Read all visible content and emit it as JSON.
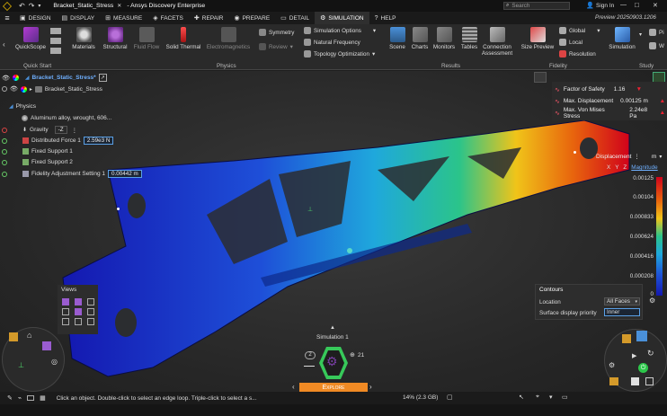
{
  "titlebar": {
    "doc_title": "Bracket_Static_Stress",
    "app_title": "- Ansys Discovery Enterprise",
    "search_placeholder": "Search",
    "sign_in": "Sign In",
    "window_controls": [
      "—",
      "□",
      "✕"
    ]
  },
  "tabs": [
    {
      "label": "Design",
      "icon": "design-icon"
    },
    {
      "label": "Display",
      "icon": "display-icon"
    },
    {
      "label": "Measure",
      "icon": "measure-icon"
    },
    {
      "label": "Facets",
      "icon": "facets-icon"
    },
    {
      "label": "Repair",
      "icon": "repair-icon"
    },
    {
      "label": "Prepare",
      "icon": "prepare-icon"
    },
    {
      "label": "Detail",
      "icon": "detail-icon"
    },
    {
      "label": "Simulation",
      "icon": "simulation-icon",
      "active": true
    },
    {
      "label": "Help",
      "icon": "help-icon"
    }
  ],
  "preview_label": "Preview 20250903.1206",
  "ribbon": {
    "quickscope": "QuickScope",
    "materials": "Materials",
    "structural": "Structural",
    "fluid_flow": "Fluid Flow",
    "solid_thermal": "Solid Thermal",
    "electromagnetics": "Electromagnetics",
    "symmetry": "Symmetry",
    "review": "Review",
    "simulation_options": "Simulation Options",
    "natural_frequency": "Natural Frequency",
    "topology_optimization": "Topology Optimization",
    "scene": "Scene",
    "charts": "Charts",
    "monitors": "Monitors",
    "tables": "Tables",
    "connection_assessment_1": "Connection",
    "connection_assessment_2": "Assessment",
    "size_preview": "Size Preview",
    "global": "Global",
    "local": "Local",
    "resolution": "Resolution",
    "simulation": "Simulation",
    "p_cut": "Pi",
    "w_cut": "W",
    "groups": {
      "quick_start": "Quick Start",
      "physics": "Physics",
      "results": "Results",
      "fidelity": "Fidelity",
      "study": "Study"
    }
  },
  "tree": {
    "root": "Bracket_Static_Stress*",
    "child": "Bracket_Static_Stress",
    "physics": "Physics",
    "material": "Aluminum alloy, wrought, 606...",
    "gravity": "Gravity",
    "gravity_dir": "-Z",
    "force": "Distributed Force 1",
    "force_value": "2.59e3 N",
    "support1": "Fixed Support 1",
    "support2": "Fixed Support 2",
    "fidelity": "Fidelity Adjustment Setting 1",
    "fidelity_value": "0.00442 m"
  },
  "results_panel": [
    {
      "label": "Factor of Safety",
      "value": "1.16",
      "status": "down"
    },
    {
      "label": "Max. Displacement",
      "value": "0.00125 m",
      "status": "up"
    },
    {
      "label": "Max. Von Mises Stress",
      "value": "2.24e8 Pa",
      "status": "up"
    }
  ],
  "legend": {
    "title": "Displacement",
    "unit": "m",
    "components": [
      "X",
      "Y",
      "Z"
    ],
    "active_component": "Magnitude",
    "ticks": [
      "0.00125",
      "0.00104",
      "0.000833",
      "0.000624",
      "0.000416",
      "0.000208",
      "0"
    ],
    "colors": [
      "#d0021b",
      "#e8650d",
      "#f0c419",
      "#2bc48a",
      "#1fa8dc",
      "#1e55d8",
      "#1418b0"
    ]
  },
  "contours": {
    "title": "Contours",
    "location_label": "Location",
    "location_value": "All Faces",
    "priority_label": "Surface display priority",
    "priority_value": "Inner"
  },
  "views_label": "Views",
  "sim_nav": {
    "label": "Simulation 1",
    "left_count": "2",
    "right_count": "21",
    "explore": "Explore"
  },
  "status": {
    "hint": "Click an object. Double-click to select an edge loop. Triple-click to select a s...",
    "memory": "14% (2.3 GB)"
  },
  "colors": {
    "accent": "#3a8fd8",
    "explore_orange": "#f08a24",
    "sim_green": "#37c95a",
    "sim_purple": "#7a3fa6"
  }
}
